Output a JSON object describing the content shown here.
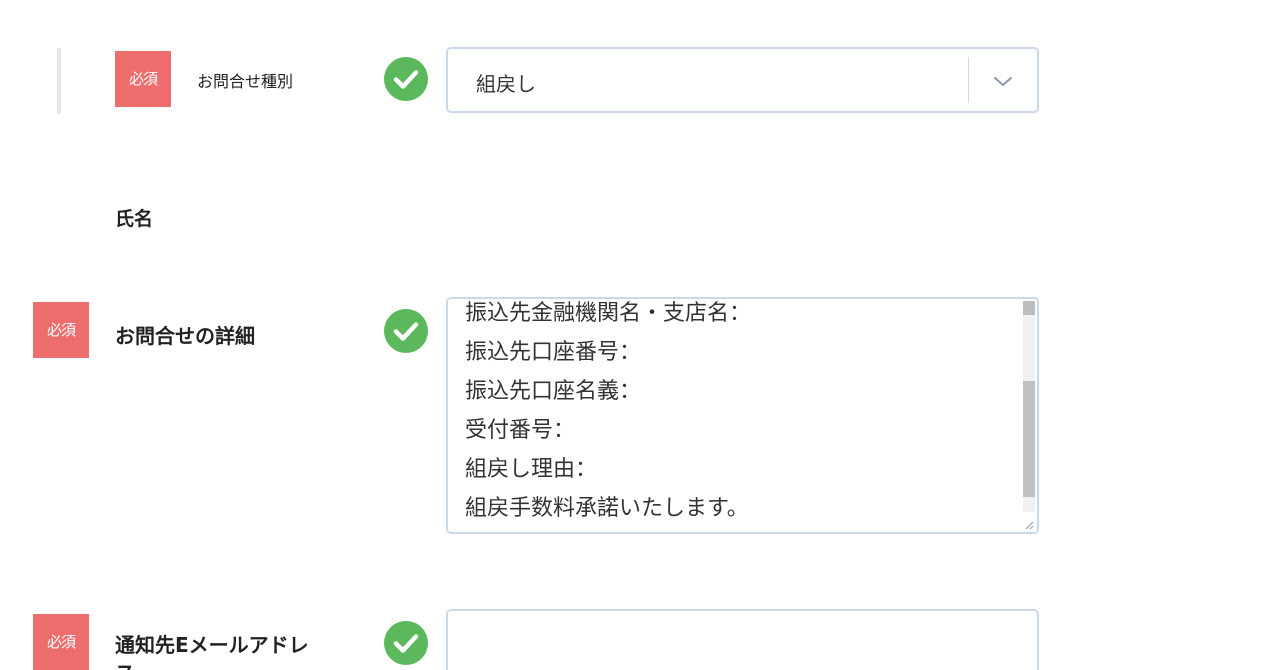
{
  "fields": {
    "inquiry_type": {
      "required_badge": "必須",
      "label": "お問合せ種別",
      "value": "組戻し"
    },
    "name": {
      "label": "氏名"
    },
    "details": {
      "required_badge": "必須",
      "label": "お問合せの詳細",
      "lines": [
        "振込先金融機関名・支店名：",
        "振込先口座番号：",
        "振込先口座名義：",
        "受付番号：",
        "組戻し理由：",
        "組戻手数料承諾いたします。"
      ]
    },
    "email": {
      "required_badge": "必須",
      "label_line1": "通知先Eメールアドレ",
      "label_line2": "ス",
      "value": ""
    }
  },
  "icons": {
    "valid": "check-circle-icon",
    "dropdown": "chevron-down-icon"
  },
  "colors": {
    "required_badge": "#ee6e6e",
    "valid_check": "#5cb85c",
    "field_border": "#c9d9ea"
  }
}
